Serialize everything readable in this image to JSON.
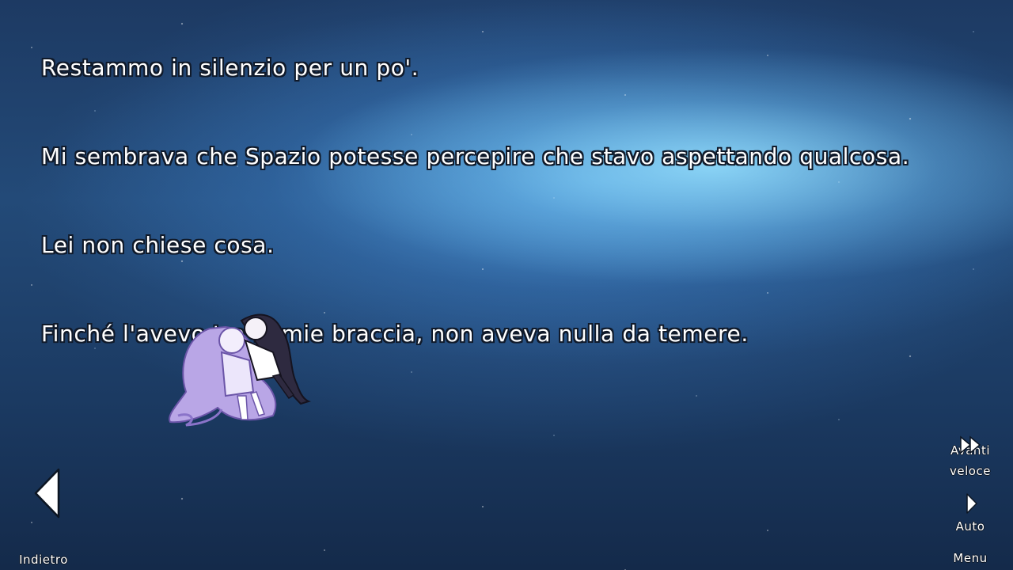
{
  "dialogue": {
    "lines": [
      "Restammo in silenzio per un po'.",
      "Mi sembrava che Spazio potesse percepire che stavo aspettando qualcosa.",
      "Lei non chiese cosa.",
      "Finché l'avevo tra le mie braccia, non aveva nulla da temere."
    ]
  },
  "controls": {
    "back_label": "Indietro",
    "fast_forward_label_1": "Avanti",
    "fast_forward_label_2": "veloce",
    "auto_label": "Auto",
    "menu_label": "Menu"
  },
  "icons": {
    "back": "triangle-left-icon",
    "fast_forward": "double-chevron-right-icon",
    "auto": "triangle-right-icon"
  },
  "colors": {
    "text": "#ffffff",
    "text_outline": "#101a2a",
    "nebula_light": "#96e1ff",
    "sky_dark": "#142a4a"
  }
}
